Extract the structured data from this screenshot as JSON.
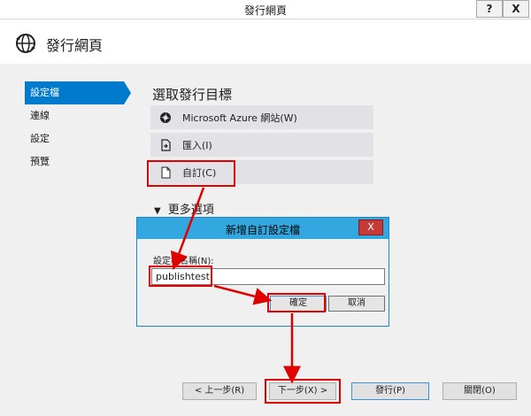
{
  "window": {
    "title": "發行網頁",
    "help_label": "?",
    "close_label": "X"
  },
  "header": {
    "title": "發行網頁"
  },
  "nav": {
    "items": [
      "設定檔",
      "連線",
      "設定",
      "預覽"
    ]
  },
  "main": {
    "section_title": "選取發行目標",
    "targets": [
      {
        "label": "Microsoft Azure 網站(W)",
        "icon": "azure-icon"
      },
      {
        "label": "匯入(I)",
        "icon": "import-icon"
      },
      {
        "label": "自訂(C)",
        "icon": "file-icon"
      }
    ],
    "more_options": "更多選項"
  },
  "dialog": {
    "title": "新增自訂設定檔",
    "close_label": "X",
    "field_label": "設定檔名稱(N):",
    "field_value": "publishtest",
    "ok_label": "確定",
    "cancel_label": "取消"
  },
  "footer": {
    "prev_label": "< 上一步(R)",
    "next_label": "下一步(X) >",
    "publish_label": "發行(P)",
    "close_label": "關閉(O)"
  },
  "colors": {
    "accent": "#007acc",
    "highlight": "#e00000",
    "dialog_title": "#32a7e0"
  }
}
